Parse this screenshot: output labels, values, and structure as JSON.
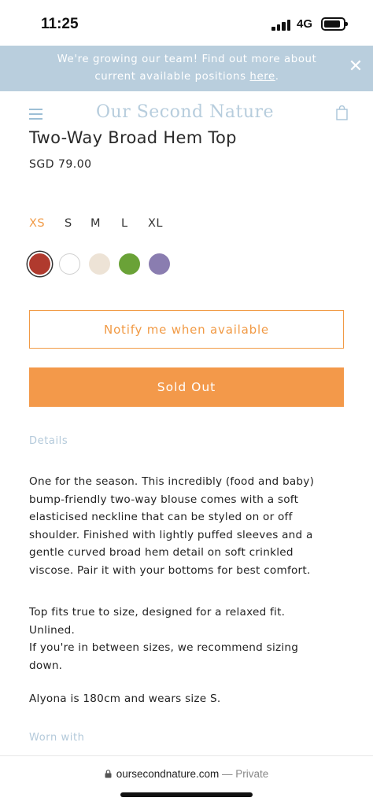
{
  "status_bar": {
    "time": "11:25",
    "network": "4G"
  },
  "announcement": {
    "text_line1": "We're growing our team! Find out more about",
    "text_line2_prefix": "current available positions ",
    "link_text": "here",
    "text_line2_suffix": ".",
    "close_label": "✕"
  },
  "header": {
    "logo": "Our Second Nature",
    "menu_icon": "hamburger-icon",
    "cart_icon": "shopping-bag-icon"
  },
  "product": {
    "title": "Two-Way Broad Hem Top",
    "price": "SGD 79.00",
    "sizes": [
      "XS",
      "S",
      "M",
      "L",
      "XL"
    ],
    "selected_size": "XS",
    "swatches": [
      "#b03a2e",
      "#ffffff",
      "#ede3d6",
      "#6aa237",
      "#8a7db0"
    ],
    "accent_color": "#f19a45"
  },
  "actions": {
    "notify_label": "Notify me when available",
    "soldout_label": "Sold Out"
  },
  "details": {
    "label": "Details",
    "description_lines": [
      "One for the season. This incredibly (food and baby)",
      "bump-friendly two-way blouse comes with a soft",
      "elasticised neckline that can be styled on or off",
      "shoulder. Finished with lightly puffed sleeves and a",
      "gentle curved broad hem detail on soft crinkled",
      "viscose. Pair it with your bottoms for best comfort."
    ],
    "fit_lines": [
      "Top fits true to size, designed for a relaxed fit.",
      "Unlined.",
      "If you're in between sizes, we recommend sizing",
      "down."
    ],
    "model_note": "Alyona is 180cm and wears size S."
  },
  "worn_with_label": "Worn with",
  "browser": {
    "url": "oursecondnature.com",
    "mode": "— Private"
  }
}
